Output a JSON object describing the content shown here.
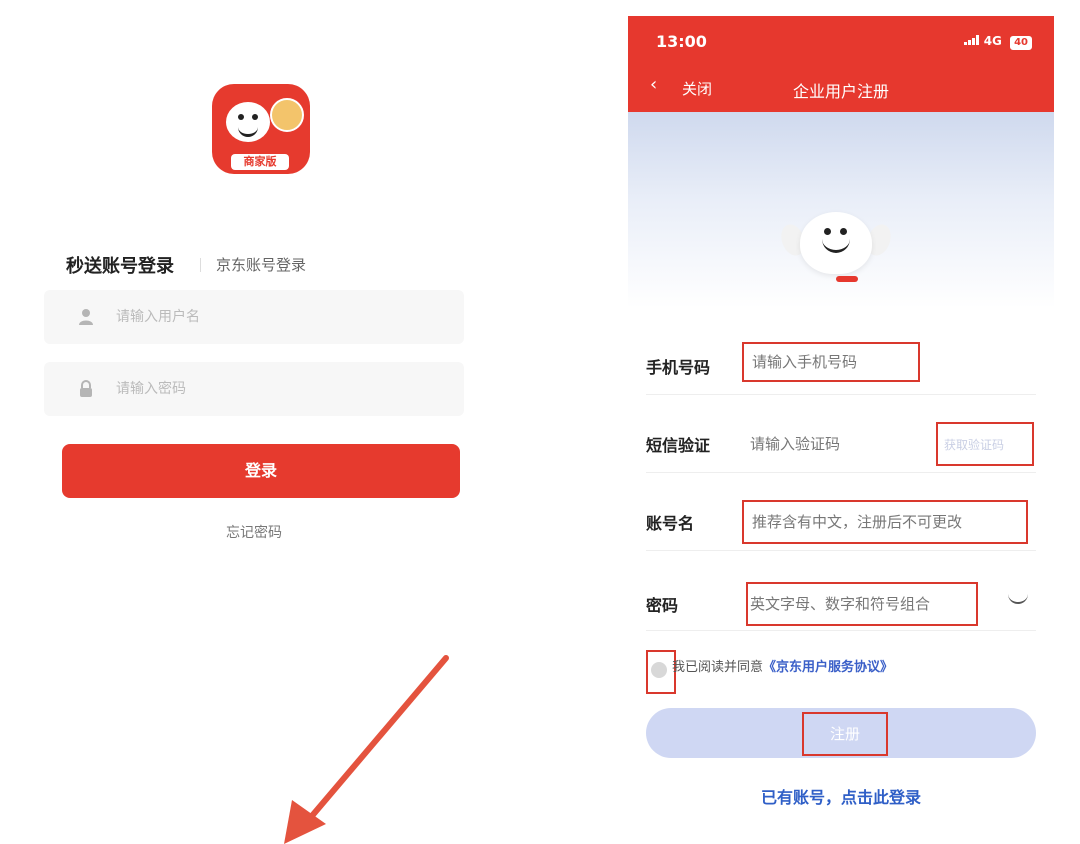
{
  "login": {
    "logo_badge": "商家版",
    "tab_active": "秒送账号登录",
    "tab_other": "京东账号登录",
    "username_placeholder": "请输入用户名",
    "password_placeholder": "请输入密码",
    "login_button": "登录",
    "forgot_password": "忘记密码"
  },
  "register": {
    "status_time": "13:00",
    "status_network": "4G",
    "status_battery": "40",
    "back_label": "关闭",
    "title": "企业用户注册",
    "fields": [
      {
        "label": "手机号码",
        "placeholder": "请输入手机号码"
      },
      {
        "label": "短信验证",
        "placeholder": "请输入验证码",
        "action": "获取验证码"
      },
      {
        "label": "账号名",
        "placeholder": "推荐含有中文，注册后不可更改"
      },
      {
        "label": "密码",
        "placeholder": "英文字母、数字和符号组合"
      }
    ],
    "agree_prefix": "我已阅读并同意",
    "agree_link": "《京东用户服务协议》",
    "register_button": "注册",
    "login_link": "已有账号，点击此登录"
  },
  "colors": {
    "brand_red": "#e63a2e",
    "annotation_red": "#d9382d",
    "link_blue": "#2f5fc7",
    "register_disabled": "#cfd7f3"
  },
  "icons": [
    "user-icon",
    "lock-icon",
    "back-chevron-icon",
    "eye-toggle-icon",
    "signal-icon",
    "battery-icon",
    "annotation-arrow"
  ]
}
